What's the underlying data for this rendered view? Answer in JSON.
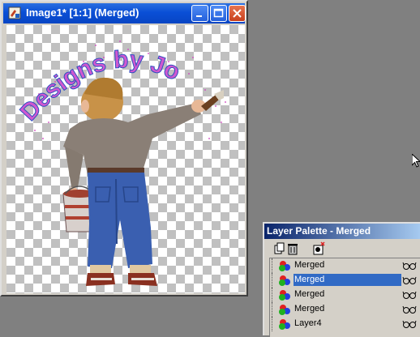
{
  "window": {
    "title": "Image1* [1:1] (Merged)",
    "buttons": [
      "minimize",
      "maximize",
      "close"
    ]
  },
  "canvas": {
    "watermark_text": "Designs by Jo"
  },
  "palette": {
    "title": "Layer Palette - Merged",
    "toolbar": [
      "new-layer-icon",
      "delete-layer-icon",
      "mask-icon"
    ],
    "layers": [
      {
        "name": "Merged",
        "selected": false
      },
      {
        "name": "Merged",
        "selected": true
      },
      {
        "name": "Merged",
        "selected": false
      },
      {
        "name": "Merged",
        "selected": false
      },
      {
        "name": "Layer4",
        "selected": false
      }
    ]
  },
  "colors": {
    "titlebar": "#0a4fd6",
    "palette_title": "#0a246a",
    "selection": "#316ac5",
    "desktop": "#808080"
  }
}
